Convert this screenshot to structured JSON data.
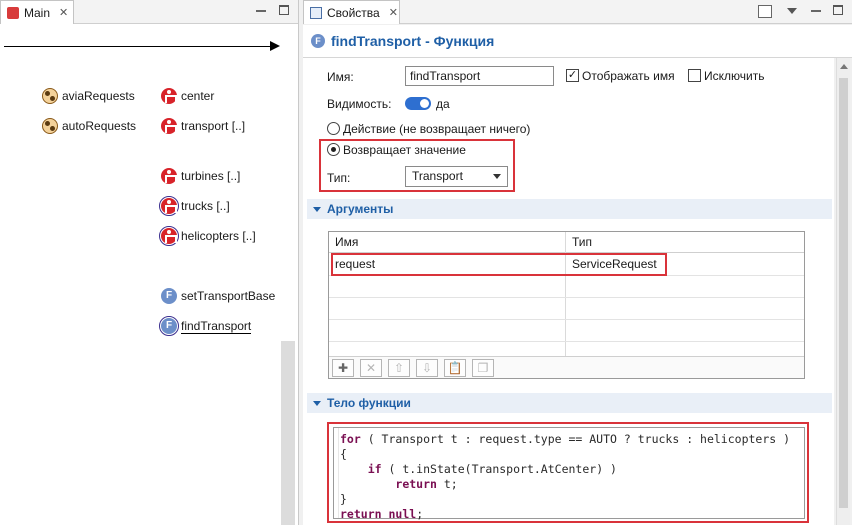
{
  "left_panel": {
    "tab_label": "Main",
    "items": [
      {
        "label": "aviaRequests",
        "icon": "collection-icon"
      },
      {
        "label": "autoRequests",
        "icon": "collection-icon"
      },
      {
        "label": "center",
        "icon": "agent-icon"
      },
      {
        "label": "transport [..]",
        "icon": "agent-icon"
      },
      {
        "label": "turbines [..]",
        "icon": "agent-icon"
      },
      {
        "label": "trucks [..]",
        "icon": "agent-icon"
      },
      {
        "label": "helicopters [..]",
        "icon": "agent-icon"
      },
      {
        "label": "setTransportBase",
        "icon": "function-icon"
      },
      {
        "label": "findTransport",
        "icon": "function-icon"
      }
    ]
  },
  "right_panel": {
    "tab_label": "Свойства",
    "title": "findTransport - Функция",
    "name_label": "Имя:",
    "name_value": "findTransport",
    "show_name_label": "Отображать имя",
    "exclude_label": "Исключить",
    "visibility_label": "Видимость:",
    "visibility_value": "да",
    "action_label": "Действие (не возвращает ничего)",
    "returns_label": "Возвращает значение",
    "type_label": "Тип:",
    "type_value": "Transport",
    "arguments_section": "Аргументы",
    "args_columns": [
      "Имя",
      "Тип"
    ],
    "args_rows": [
      {
        "name": "request",
        "type": "ServiceRequest"
      }
    ],
    "body_section": "Тело функции",
    "code_lines": [
      "for ( Transport t : request.type == AUTO ? trucks : helicopters )",
      "{",
      "    if ( t.inState(Transport.AtCenter) )",
      "        return t;",
      "}",
      "return null;"
    ]
  },
  "colors": {
    "accent_blue": "#1f5fa6",
    "highlight_red": "#d9333a",
    "agent_red": "#d8232a",
    "function_blue": "#6c8fc9"
  }
}
